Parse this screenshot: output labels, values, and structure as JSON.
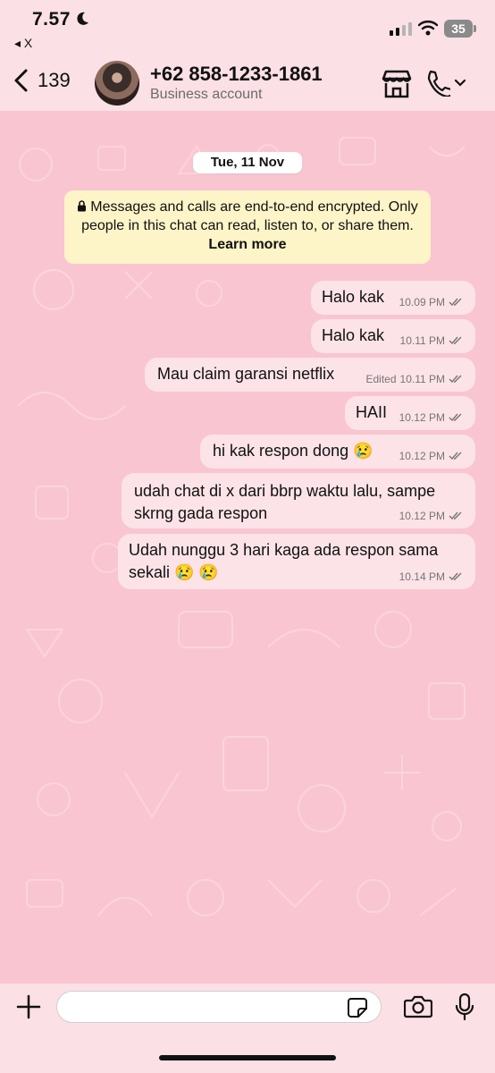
{
  "status": {
    "time": "7.57",
    "back_app": "◂ X",
    "battery": "35"
  },
  "header": {
    "back_count": "139",
    "contact_name": "+62 858-1233-1861",
    "contact_subtitle": "Business account"
  },
  "chat": {
    "date_chip": "Tue, 11 Nov",
    "encryption_notice": "Messages and calls are end-to-end encrypted. Only people in this chat can read, listen to, or share them.",
    "encryption_link": "Learn more",
    "messages": [
      {
        "text": "Halo kak",
        "time": "10.09 PM",
        "edited": ""
      },
      {
        "text": "Halo kak",
        "time": "10.11 PM",
        "edited": ""
      },
      {
        "text": "Mau claim garansi netflix",
        "time": "10.11 PM",
        "edited": "Edited"
      },
      {
        "text": "HAII",
        "time": "10.12 PM",
        "edited": ""
      },
      {
        "text": "hi kak respon dong 😢",
        "time": "10.12 PM",
        "edited": ""
      },
      {
        "text": "udah chat di x dari bbrp waktu lalu, sampe skrng gada respon",
        "time": "10.12 PM",
        "edited": ""
      },
      {
        "text": "Udah nunggu 3 hari kaga ada respon sama sekali 😢 😢",
        "time": "10.14 PM",
        "edited": ""
      }
    ]
  },
  "input": {
    "placeholder": ""
  },
  "colors": {
    "chat_bg": "#f9c5d1",
    "bar_bg": "#fbe0e6",
    "bubble_out": "#fbe3e8",
    "notice_bg": "#fdf4c8",
    "tick_grey": "#757575"
  },
  "icons": [
    "moon-icon",
    "signal-icon",
    "wifi-icon",
    "battery-icon",
    "back-chevron-icon",
    "store-icon",
    "phone-icon",
    "chevron-down-icon",
    "lock-icon",
    "double-check-icon",
    "plus-icon",
    "sticker-icon",
    "camera-icon",
    "mic-icon"
  ]
}
